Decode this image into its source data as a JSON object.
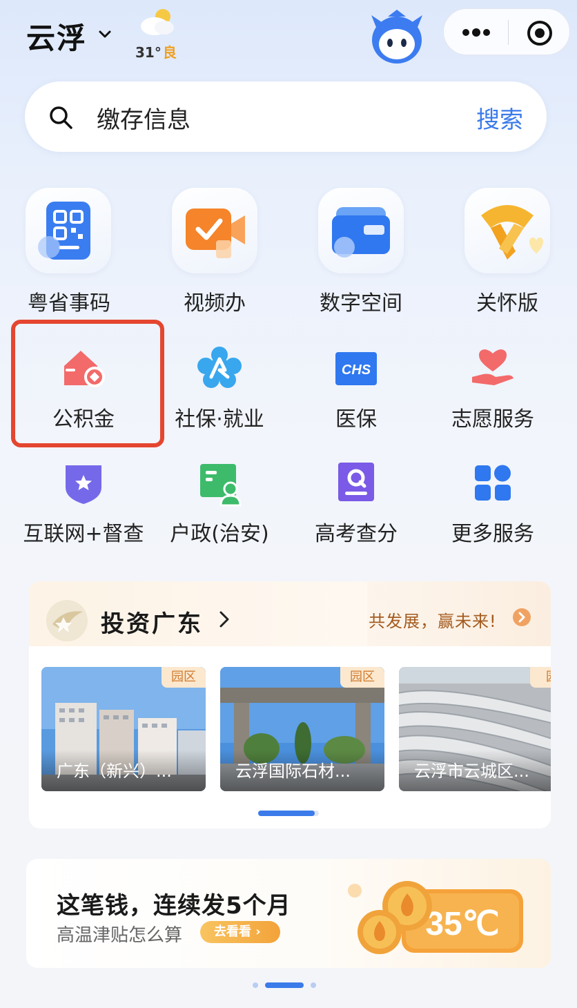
{
  "header": {
    "city": "云浮",
    "weather_temp": "31°",
    "weather_quality": "良"
  },
  "search": {
    "value": "缴存信息",
    "button": "搜索"
  },
  "top_services": [
    {
      "label": "粤省事码",
      "icon": "qr-code-icon"
    },
    {
      "label": "视频办",
      "icon": "video-call-icon"
    },
    {
      "label": "数字空间",
      "icon": "wallet-icon"
    },
    {
      "label": "关怀版",
      "icon": "scarf-heart-icon"
    }
  ],
  "services": [
    {
      "label": "公积金",
      "icon": "housing-fund-icon"
    },
    {
      "label": "社保·就业",
      "icon": "social-security-icon"
    },
    {
      "label": "医保",
      "icon": "chs-icon",
      "icon_text": "CHS"
    },
    {
      "label": "志愿服务",
      "icon": "volunteer-heart-icon"
    },
    {
      "label": "互联网+督查",
      "icon": "shield-star-icon"
    },
    {
      "label": "户政(治安)",
      "icon": "id-card-icon"
    },
    {
      "label": "高考查分",
      "icon": "exam-search-icon"
    },
    {
      "label": "更多服务",
      "icon": "grid-more-icon"
    }
  ],
  "invest": {
    "title": "投资广东",
    "slogan": "共发展，赢未来!",
    "cards": [
      {
        "tag": "园区",
        "caption": "广东（新兴）..."
      },
      {
        "tag": "园区",
        "caption": "云浮国际石材..."
      },
      {
        "tag": "园",
        "caption": "云浮市云城区..."
      }
    ]
  },
  "subsidy": {
    "title": "这笔钱，连续发5个月",
    "desc": "高温津贴怎么算",
    "button": "去看看",
    "badge": "35℃"
  },
  "colors": {
    "accent": "#3b7bea",
    "highlight": "#e44630"
  }
}
